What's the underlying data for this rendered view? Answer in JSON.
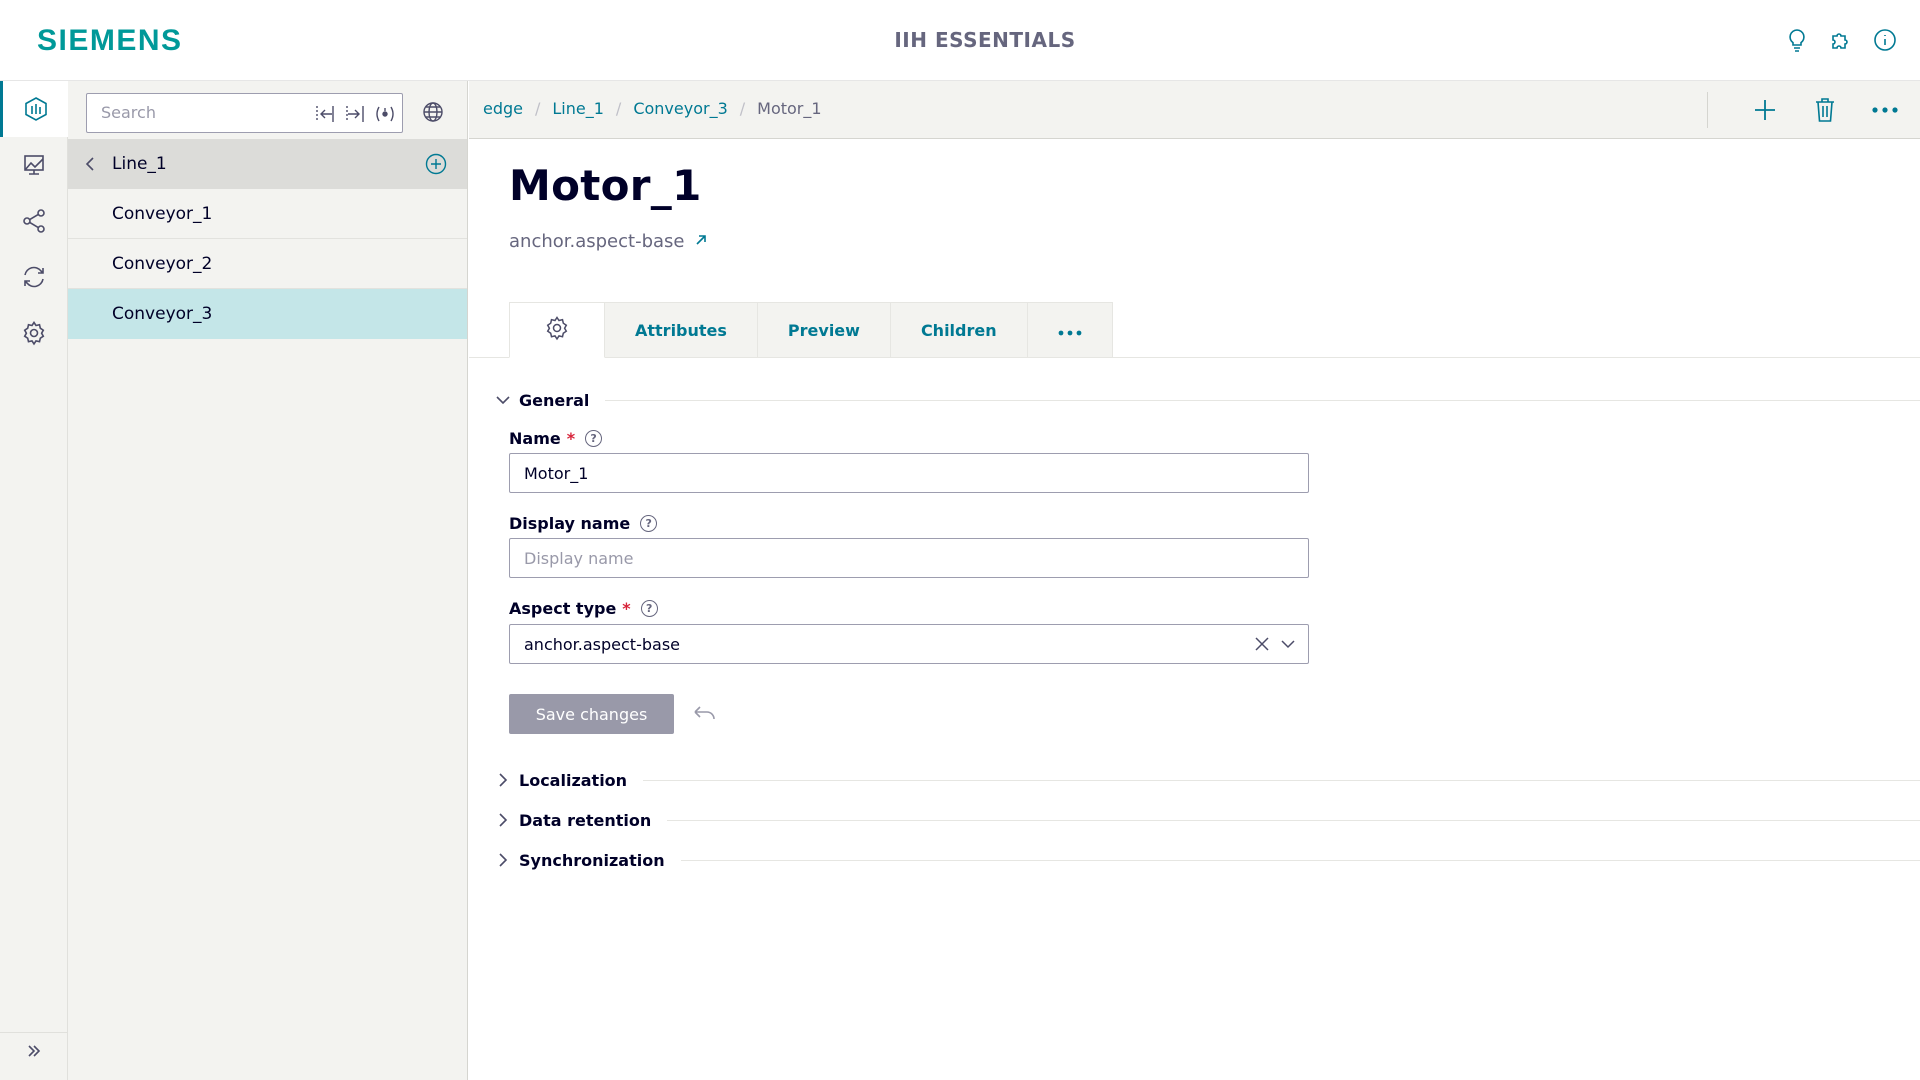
{
  "header": {
    "logo": "SIEMENS",
    "app_title": "IIH ESSENTIALS",
    "icons": [
      "lightbulb-icon",
      "puzzle-icon",
      "info-icon"
    ]
  },
  "rail": {
    "items": [
      "asset-model-icon",
      "dashboard-icon",
      "connections-icon",
      "sync-icon",
      "settings-icon"
    ],
    "expand_icon": "double-chevron-right-icon"
  },
  "tree": {
    "search_placeholder": "Search",
    "parent": "Line_1",
    "items": [
      "Conveyor_1",
      "Conveyor_2",
      "Conveyor_3"
    ],
    "selected": "Conveyor_3"
  },
  "breadcrumb": {
    "items": [
      "edge",
      "Line_1",
      "Conveyor_3"
    ],
    "current": "Motor_1"
  },
  "toolbar": {
    "actions": [
      "add-icon",
      "delete-icon",
      "more-icon"
    ]
  },
  "asset": {
    "title": "Motor_1",
    "aspect_link": "anchor.aspect-base"
  },
  "tabs": {
    "settings_icon": "gear-icon",
    "items": [
      "Attributes",
      "Preview",
      "Children"
    ],
    "more": "•••"
  },
  "general": {
    "section_title": "General",
    "name_label": "Name",
    "name_value": "Motor_1",
    "display_name_label": "Display name",
    "display_name_placeholder": "Display name",
    "aspect_type_label": "Aspect type",
    "aspect_type_value": "anchor.aspect-base",
    "required_marker": "*",
    "save_label": "Save changes"
  },
  "sections": {
    "localization": "Localization",
    "data_retention": "Data retention",
    "synchronization": "Synchronization"
  },
  "colors": {
    "brand": "#009999",
    "accent": "#007993",
    "selected_row": "#c4e6e8",
    "required": "#d72339"
  }
}
